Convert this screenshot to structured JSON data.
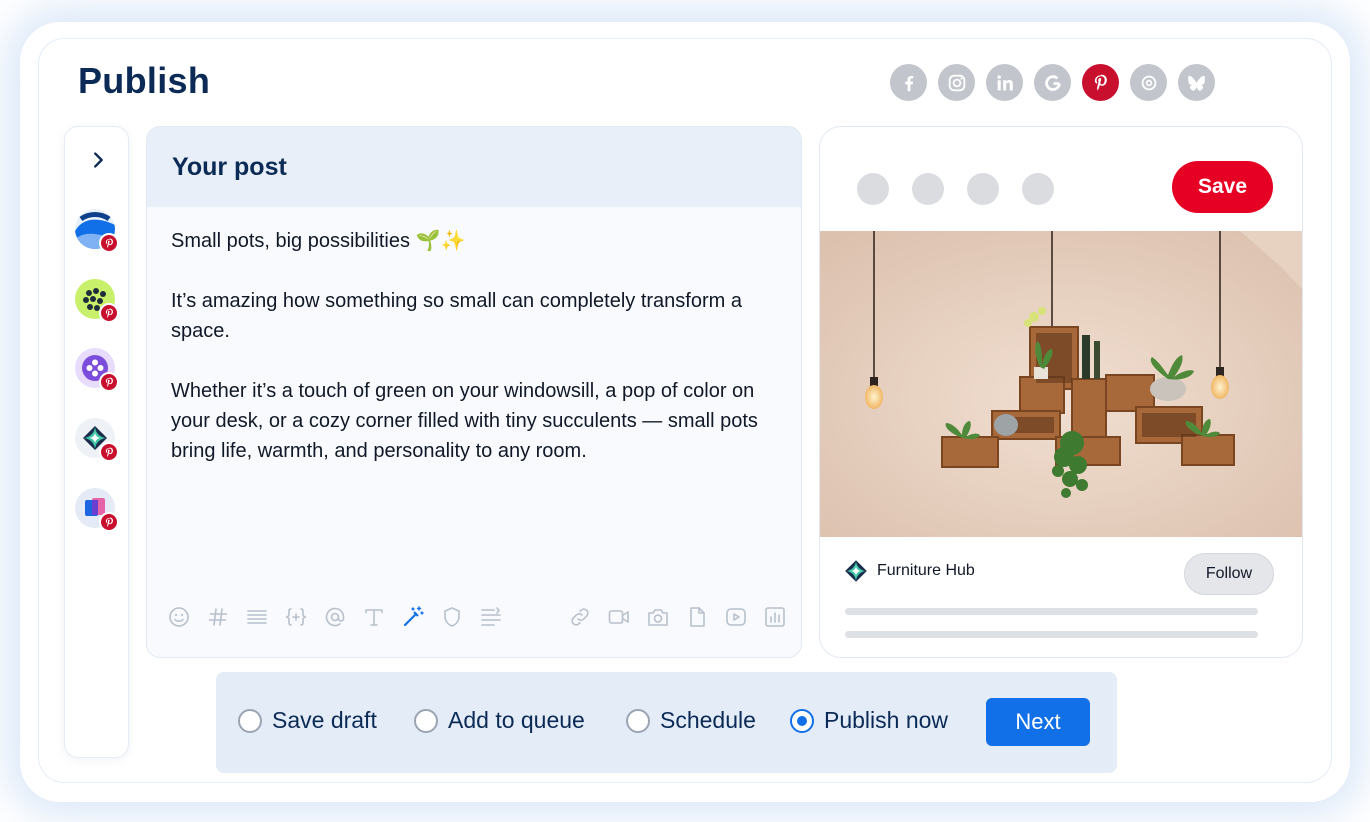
{
  "page": {
    "title": "Publish"
  },
  "networks": [
    {
      "icon": "facebook-icon",
      "active": false
    },
    {
      "icon": "instagram-icon",
      "active": false
    },
    {
      "icon": "linkedin-icon",
      "active": false
    },
    {
      "icon": "google-icon",
      "active": false
    },
    {
      "icon": "pinterest-icon",
      "active": true
    },
    {
      "icon": "threads-icon",
      "active": false
    },
    {
      "icon": "bluesky-icon",
      "active": false
    }
  ],
  "sidebar": {
    "toggle_icon": "chevron-right-icon",
    "accounts": [
      {
        "avatar": "blue-wave-logo",
        "network": "pinterest-icon"
      },
      {
        "avatar": "green-dots-logo",
        "network": "pinterest-icon"
      },
      {
        "avatar": "purple-flower-logo",
        "network": "pinterest-icon"
      },
      {
        "avatar": "furniture-hub-logo",
        "network": "pinterest-icon"
      },
      {
        "avatar": "blue-pink-logo",
        "network": "pinterest-icon"
      }
    ]
  },
  "editor": {
    "title": "Your post",
    "body": [
      "Small pots, big possibilities 🌱✨",
      "It’s amazing how something so small can completely transform a space.",
      "Whether it’s a touch of green on your windowsill, a pop of color on your desk, or a cozy corner filled with tiny succulents — small pots bring life, warmth, and personality to any room."
    ],
    "toolbar_left": [
      "emoji-icon",
      "hashtag-icon",
      "text-lines-icon",
      "variables-icon",
      "mention-icon",
      "text-format-icon",
      "ai-wand-icon",
      "shield-icon",
      "text-align-icon"
    ],
    "toolbar_right": [
      "link-icon",
      "video-icon",
      "camera-icon",
      "file-icon",
      "play-icon",
      "poll-icon"
    ]
  },
  "preview": {
    "save_label": "Save",
    "brand_name": "Furniture Hub",
    "follow_label": "Follow",
    "colors": {
      "pinterest_red": "#e60023"
    }
  },
  "actions": {
    "options": [
      {
        "label": "Save draft",
        "selected": false
      },
      {
        "label": "Add to queue",
        "selected": false
      },
      {
        "label": "Schedule",
        "selected": false
      },
      {
        "label": "Publish now",
        "selected": true
      }
    ],
    "next_label": "Next"
  }
}
